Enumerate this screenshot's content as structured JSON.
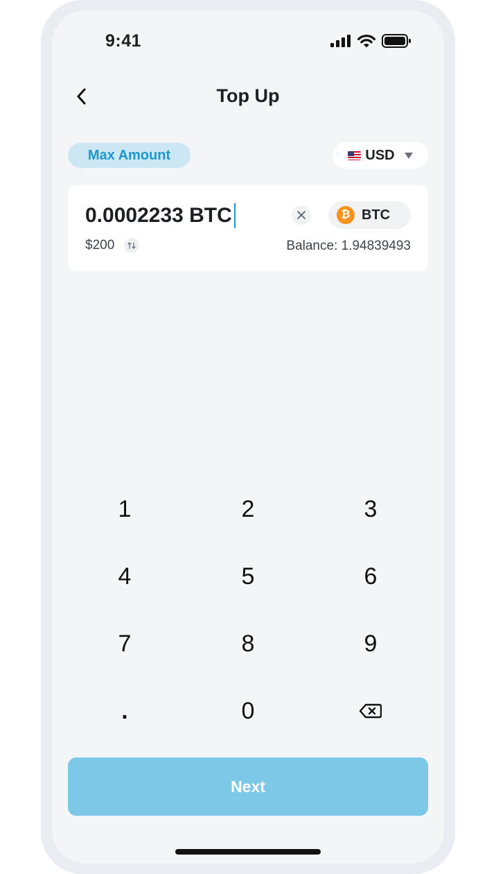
{
  "status_bar": {
    "time": "9:41"
  },
  "header": {
    "title": "Top Up",
    "back_icon": "chevron-left-icon"
  },
  "controls": {
    "max_label": "Max Amount",
    "currency": {
      "flag_icon": "us-flag-icon",
      "code": "USD",
      "caret_icon": "caret-down-icon"
    }
  },
  "amount_card": {
    "amount": "0.0002233 BTC",
    "fiat_value": "$200",
    "coin_symbol": "BTC",
    "coin_icon": "bitcoin-icon",
    "coin_glyph": "₿",
    "balance": "Balance: 1.94839493"
  },
  "keypad": {
    "keys": [
      "1",
      "2",
      "3",
      "4",
      "5",
      "6",
      "7",
      "8",
      "9",
      ".",
      "0"
    ],
    "backspace_icon": "backspace-icon"
  },
  "next_label": "Next",
  "colors": {
    "accent": "#1d98cf",
    "next_button": "#7cc8e6",
    "max_bg": "#cde6f3",
    "bitcoin": "#f7931a"
  }
}
